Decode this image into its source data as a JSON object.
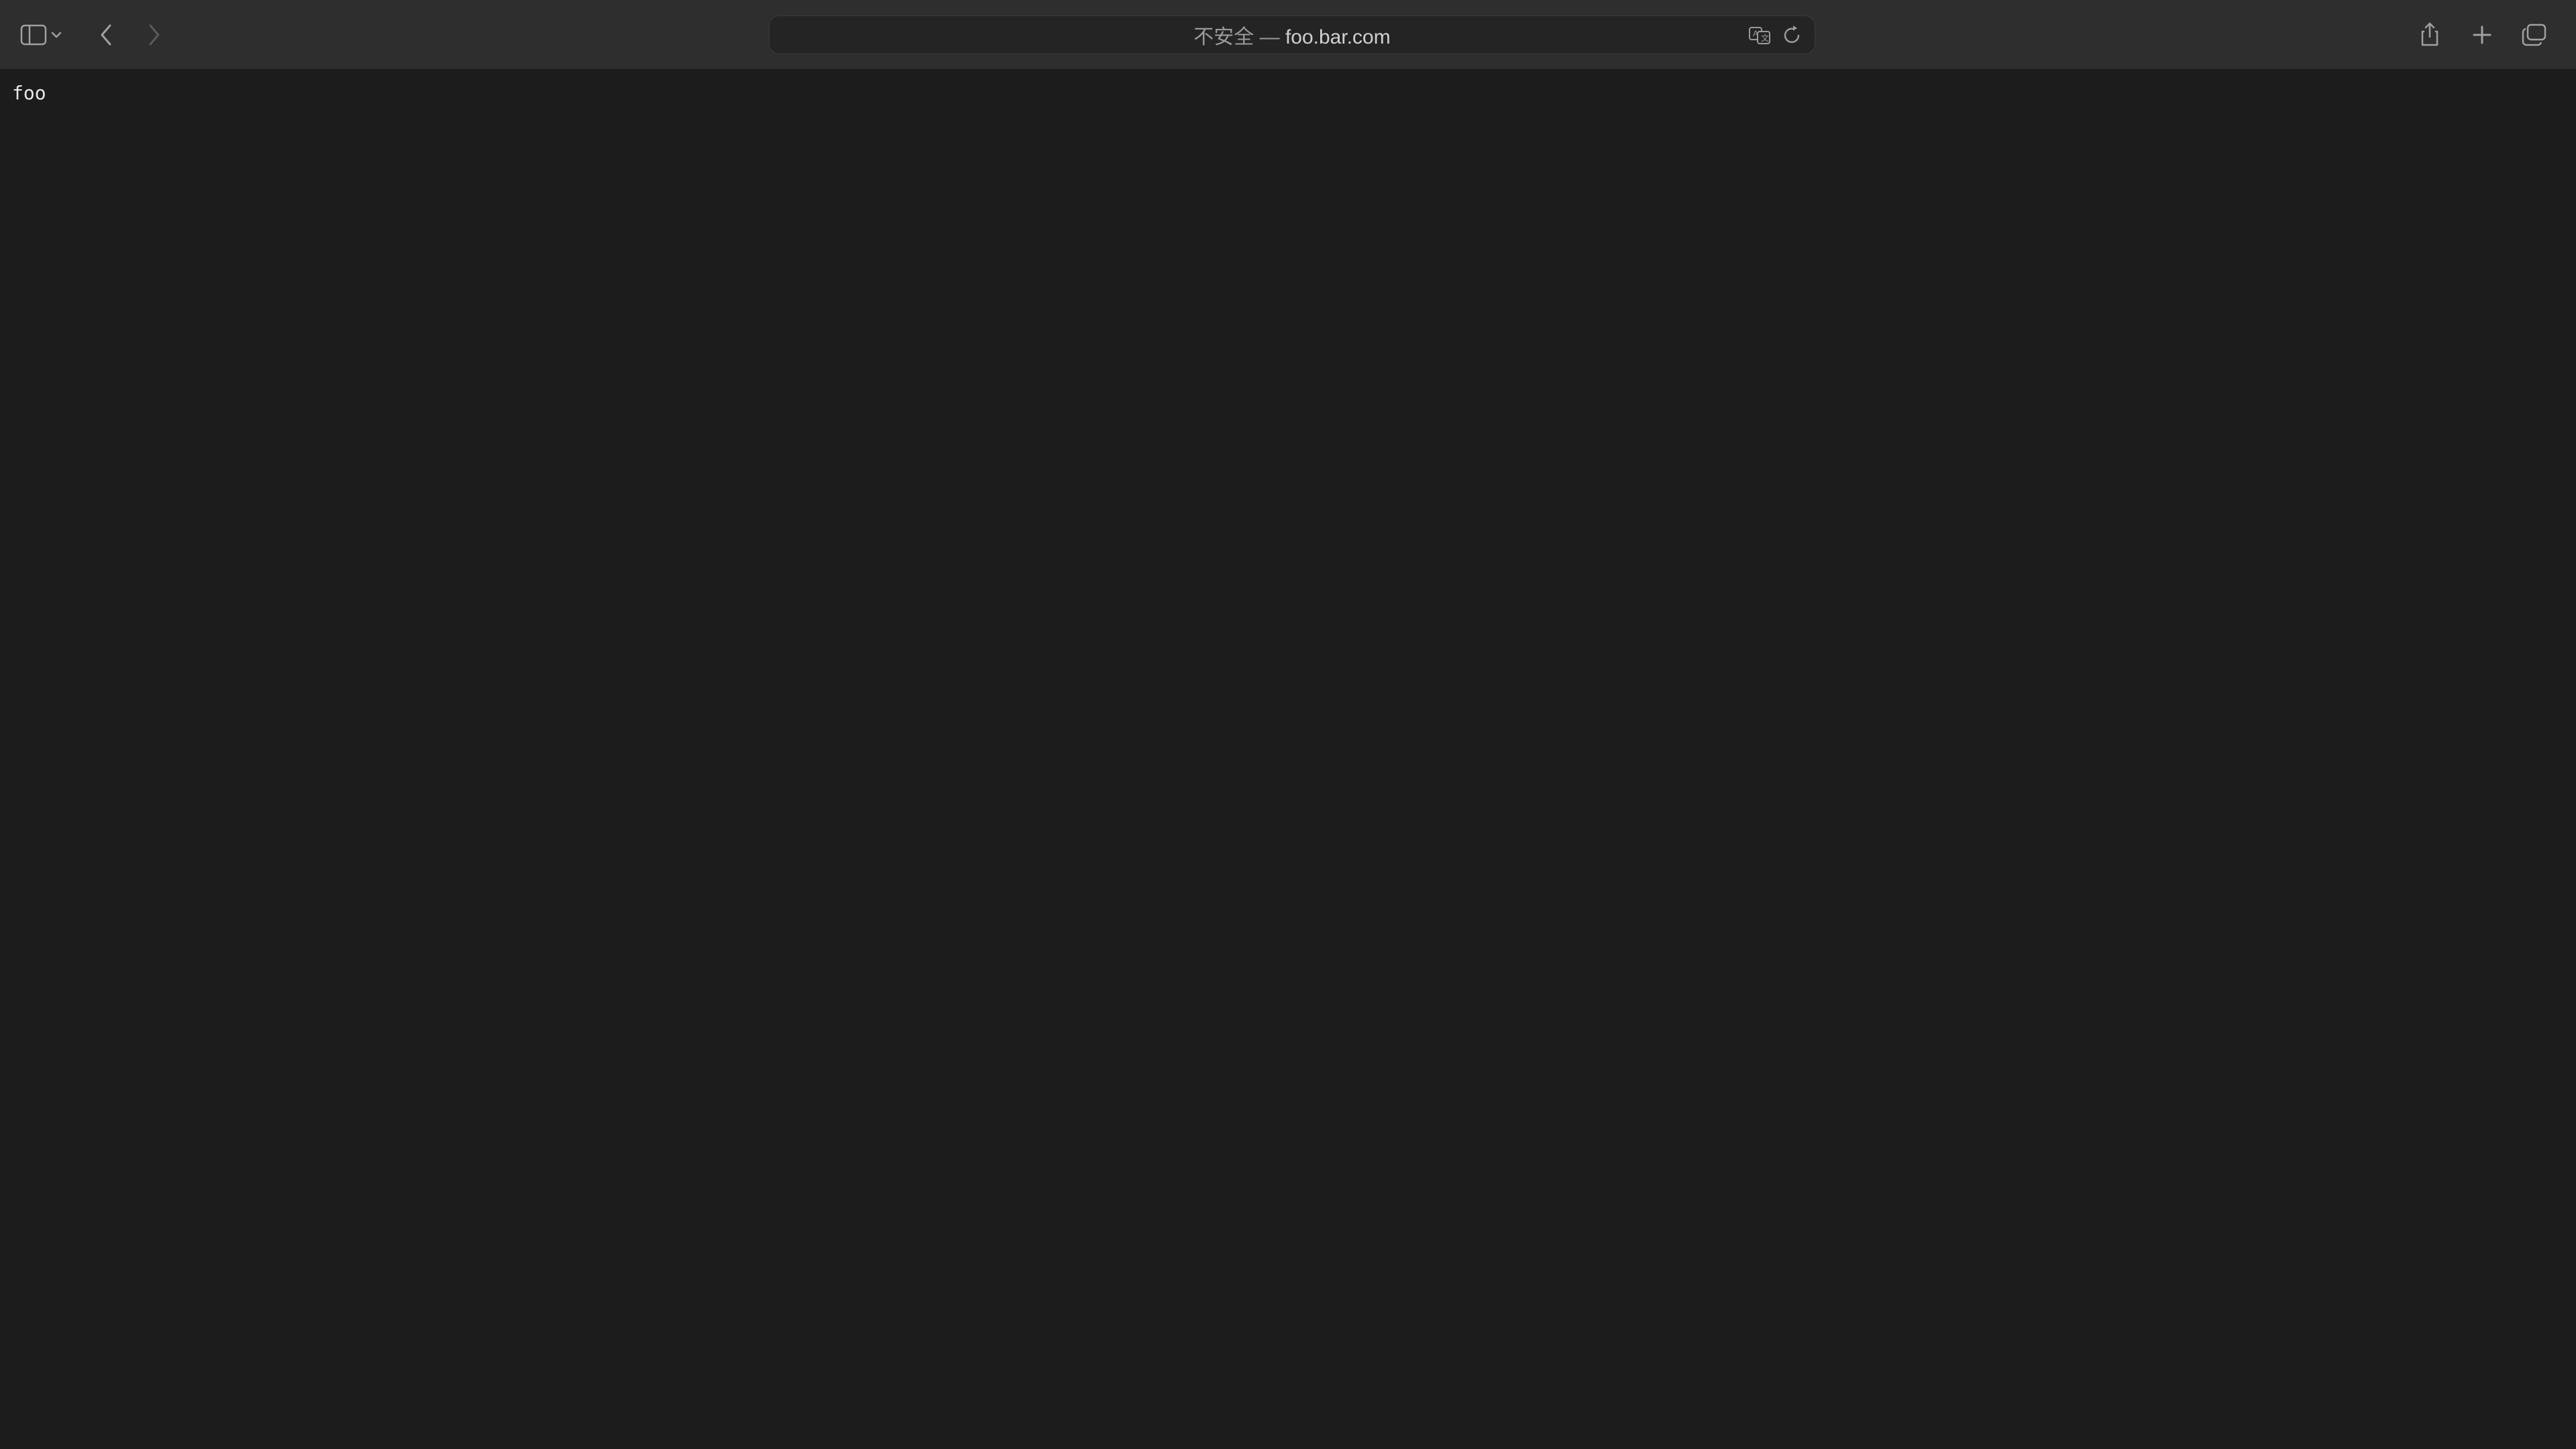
{
  "toolbar": {
    "address": {
      "prefix": "不安全 — ",
      "domain": "foo.bar.com"
    }
  },
  "page": {
    "body_text": "foo"
  }
}
